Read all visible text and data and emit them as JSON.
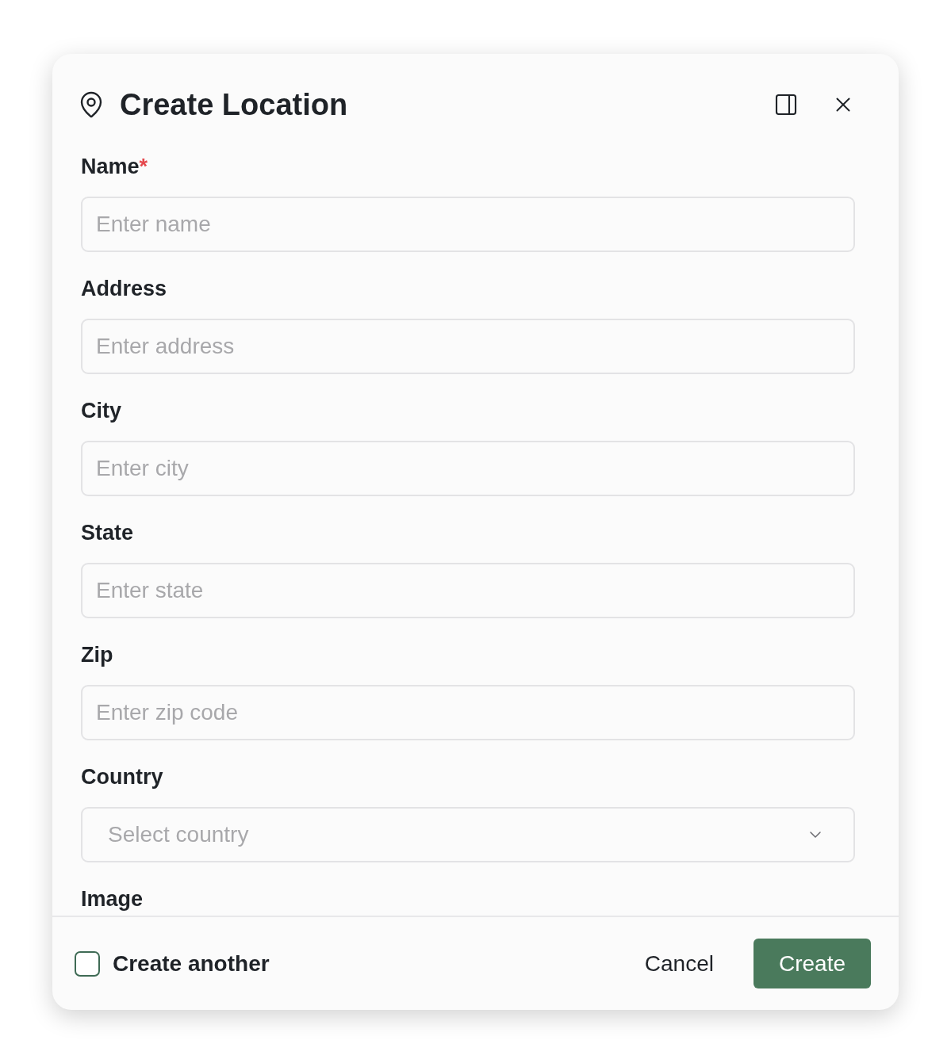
{
  "dialog": {
    "title": "Create Location",
    "fields": [
      {
        "kind": "text",
        "label": "Name",
        "required_mark": "*",
        "placeholder": "Enter name"
      },
      {
        "kind": "text",
        "label": "Address",
        "placeholder": "Enter address"
      },
      {
        "kind": "text",
        "label": "City",
        "placeholder": "Enter city"
      },
      {
        "kind": "text",
        "label": "State",
        "placeholder": "Enter state"
      },
      {
        "kind": "text",
        "label": "Zip",
        "placeholder": "Enter zip code"
      },
      {
        "kind": "select",
        "label": "Country",
        "placeholder": "Select country"
      },
      {
        "kind": "label_only",
        "label": "Image"
      }
    ],
    "footer": {
      "create_another": {
        "label": "Create another",
        "checked": false
      },
      "buttons": [
        {
          "kind": "secondary",
          "label": "Cancel"
        },
        {
          "kind": "primary",
          "label": "Create"
        }
      ]
    }
  }
}
